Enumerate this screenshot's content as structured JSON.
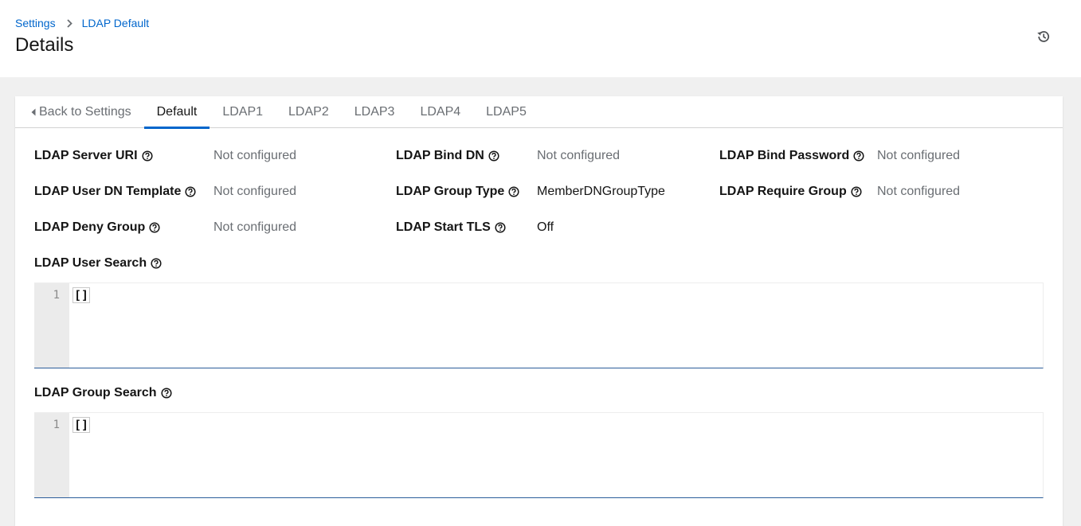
{
  "breadcrumb": {
    "parent": "Settings",
    "current": "LDAP Default"
  },
  "page_title": "Details",
  "tabs": [
    "Back to Settings",
    "Default",
    "LDAP1",
    "LDAP2",
    "LDAP3",
    "LDAP4",
    "LDAP5"
  ],
  "active_tab": "Default",
  "details": {
    "server_uri": {
      "label": "LDAP Server URI",
      "value": "Not configured"
    },
    "bind_dn": {
      "label": "LDAP Bind DN",
      "value": "Not configured"
    },
    "bind_password": {
      "label": "LDAP Bind Password",
      "value": "Not configured"
    },
    "user_dn_template": {
      "label": "LDAP User DN Template",
      "value": "Not configured"
    },
    "group_type": {
      "label": "LDAP Group Type",
      "value": "MemberDNGroupType"
    },
    "require_group": {
      "label": "LDAP Require Group",
      "value": "Not configured"
    },
    "deny_group": {
      "label": "LDAP Deny Group",
      "value": "Not configured"
    },
    "start_tls": {
      "label": "LDAP Start TLS",
      "value": "Off"
    }
  },
  "user_search": {
    "label": "LDAP User Search",
    "line_number": "1",
    "code": "[]"
  },
  "group_search": {
    "label": "LDAP Group Search",
    "line_number": "1",
    "code": "[]"
  },
  "colors": {
    "link": "#0066cc",
    "active_tab": "#0066cc",
    "muted_text": "#6a6e73"
  },
  "icons": {
    "history": "history-icon",
    "help": "question-circle-icon",
    "breadcrumb_sep": "chevron-right-icon",
    "back": "caret-left-icon"
  }
}
